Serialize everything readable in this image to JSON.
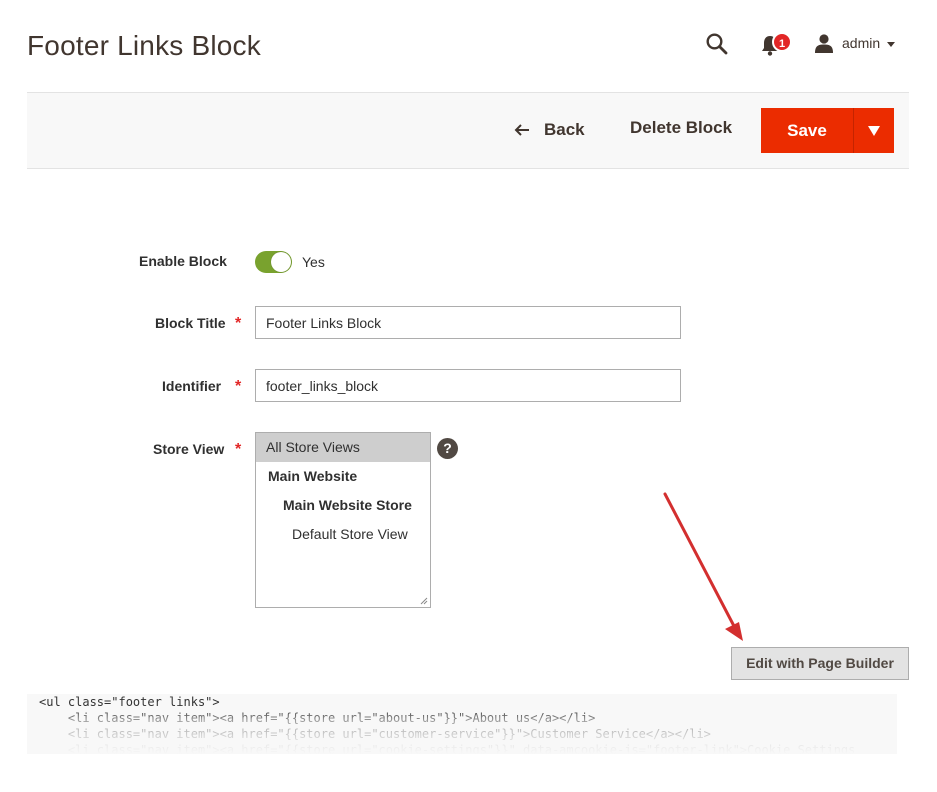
{
  "header": {
    "title": "Footer Links Block",
    "notifications_count": "1",
    "user_name": "admin"
  },
  "actions": {
    "back_label": "Back",
    "delete_label": "Delete Block",
    "save_label": "Save"
  },
  "form": {
    "enable_block": {
      "label": "Enable Block",
      "value_text": "Yes",
      "enabled": true
    },
    "block_title": {
      "label": "Block Title",
      "value": "Footer Links Block",
      "required": true
    },
    "identifier": {
      "label": "Identifier",
      "value": "footer_links_block",
      "required": true
    },
    "store_view": {
      "label": "Store View",
      "required": true,
      "options": [
        {
          "label": "All Store Views",
          "selected": true
        },
        {
          "label": "Main Website"
        },
        {
          "label": "Main Website Store"
        },
        {
          "label": "Default Store View"
        }
      ]
    }
  },
  "page_builder": {
    "button_label": "Edit with Page Builder",
    "code_lines": [
      "<ul class=\"footer links\">",
      "    <li class=\"nav item\"><a href=\"{{store url=\"about-us\"}}\">About us</a></li>",
      "    <li class=\"nav item\"><a href=\"{{store url=\"customer-service\"}}\">Customer Service</a></li>",
      "    <li class=\"nav item\"><a href=\"{{store url=\"cookie-settings\"}}\" data-amcookie-js=\"footer-link\">Cookie Settings"
    ]
  },
  "colors": {
    "primary": "#eb2c00",
    "toggle_on": "#79a22e",
    "badge": "#e22626",
    "annotation_arrow": "#d32f2f"
  },
  "icons": {
    "search": "search-icon",
    "notifications": "bell-icon",
    "user": "user-icon",
    "back": "arrow-left-icon",
    "help": "question-icon"
  }
}
